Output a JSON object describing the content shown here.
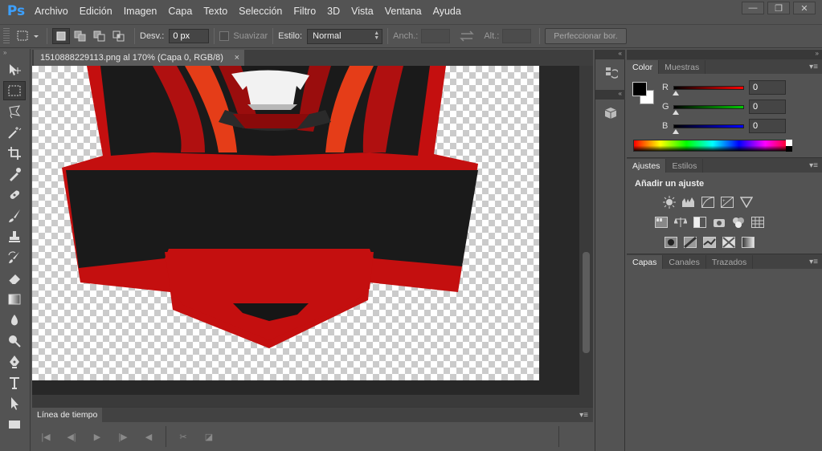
{
  "app": {
    "logo": "Ps"
  },
  "menu": [
    "Archivo",
    "Edición",
    "Imagen",
    "Capa",
    "Texto",
    "Selección",
    "Filtro",
    "3D",
    "Vista",
    "Ventana",
    "Ayuda"
  ],
  "options": {
    "feather_label": "Desv.:",
    "feather_value": "0 px",
    "antialias_label": "Suavizar",
    "style_label": "Estilo:",
    "style_value": "Normal",
    "width_label": "Anch.:",
    "height_label": "Alt.:",
    "refine_label": "Perfeccionar bor."
  },
  "document": {
    "tab_title": "1510888229113.png al 170% (Capa 0, RGB/8)",
    "close": "×"
  },
  "timeline": {
    "tab": "Línea de tiempo"
  },
  "color_panel": {
    "tabs": [
      "Color",
      "Muestras"
    ],
    "channels": [
      {
        "label": "R",
        "value": "0",
        "color": "#ff0000"
      },
      {
        "label": "G",
        "value": "0",
        "color": "#00c800"
      },
      {
        "label": "B",
        "value": "0",
        "color": "#0000ff"
      }
    ]
  },
  "adjust_panel": {
    "tabs": [
      "Ajustes",
      "Estilos"
    ],
    "title": "Añadir un ajuste"
  },
  "layers_panel": {
    "tabs": [
      "Capas",
      "Canales",
      "Trazados"
    ]
  },
  "window_controls": {
    "minimize": "—",
    "restore": "❐",
    "close": "✕"
  }
}
